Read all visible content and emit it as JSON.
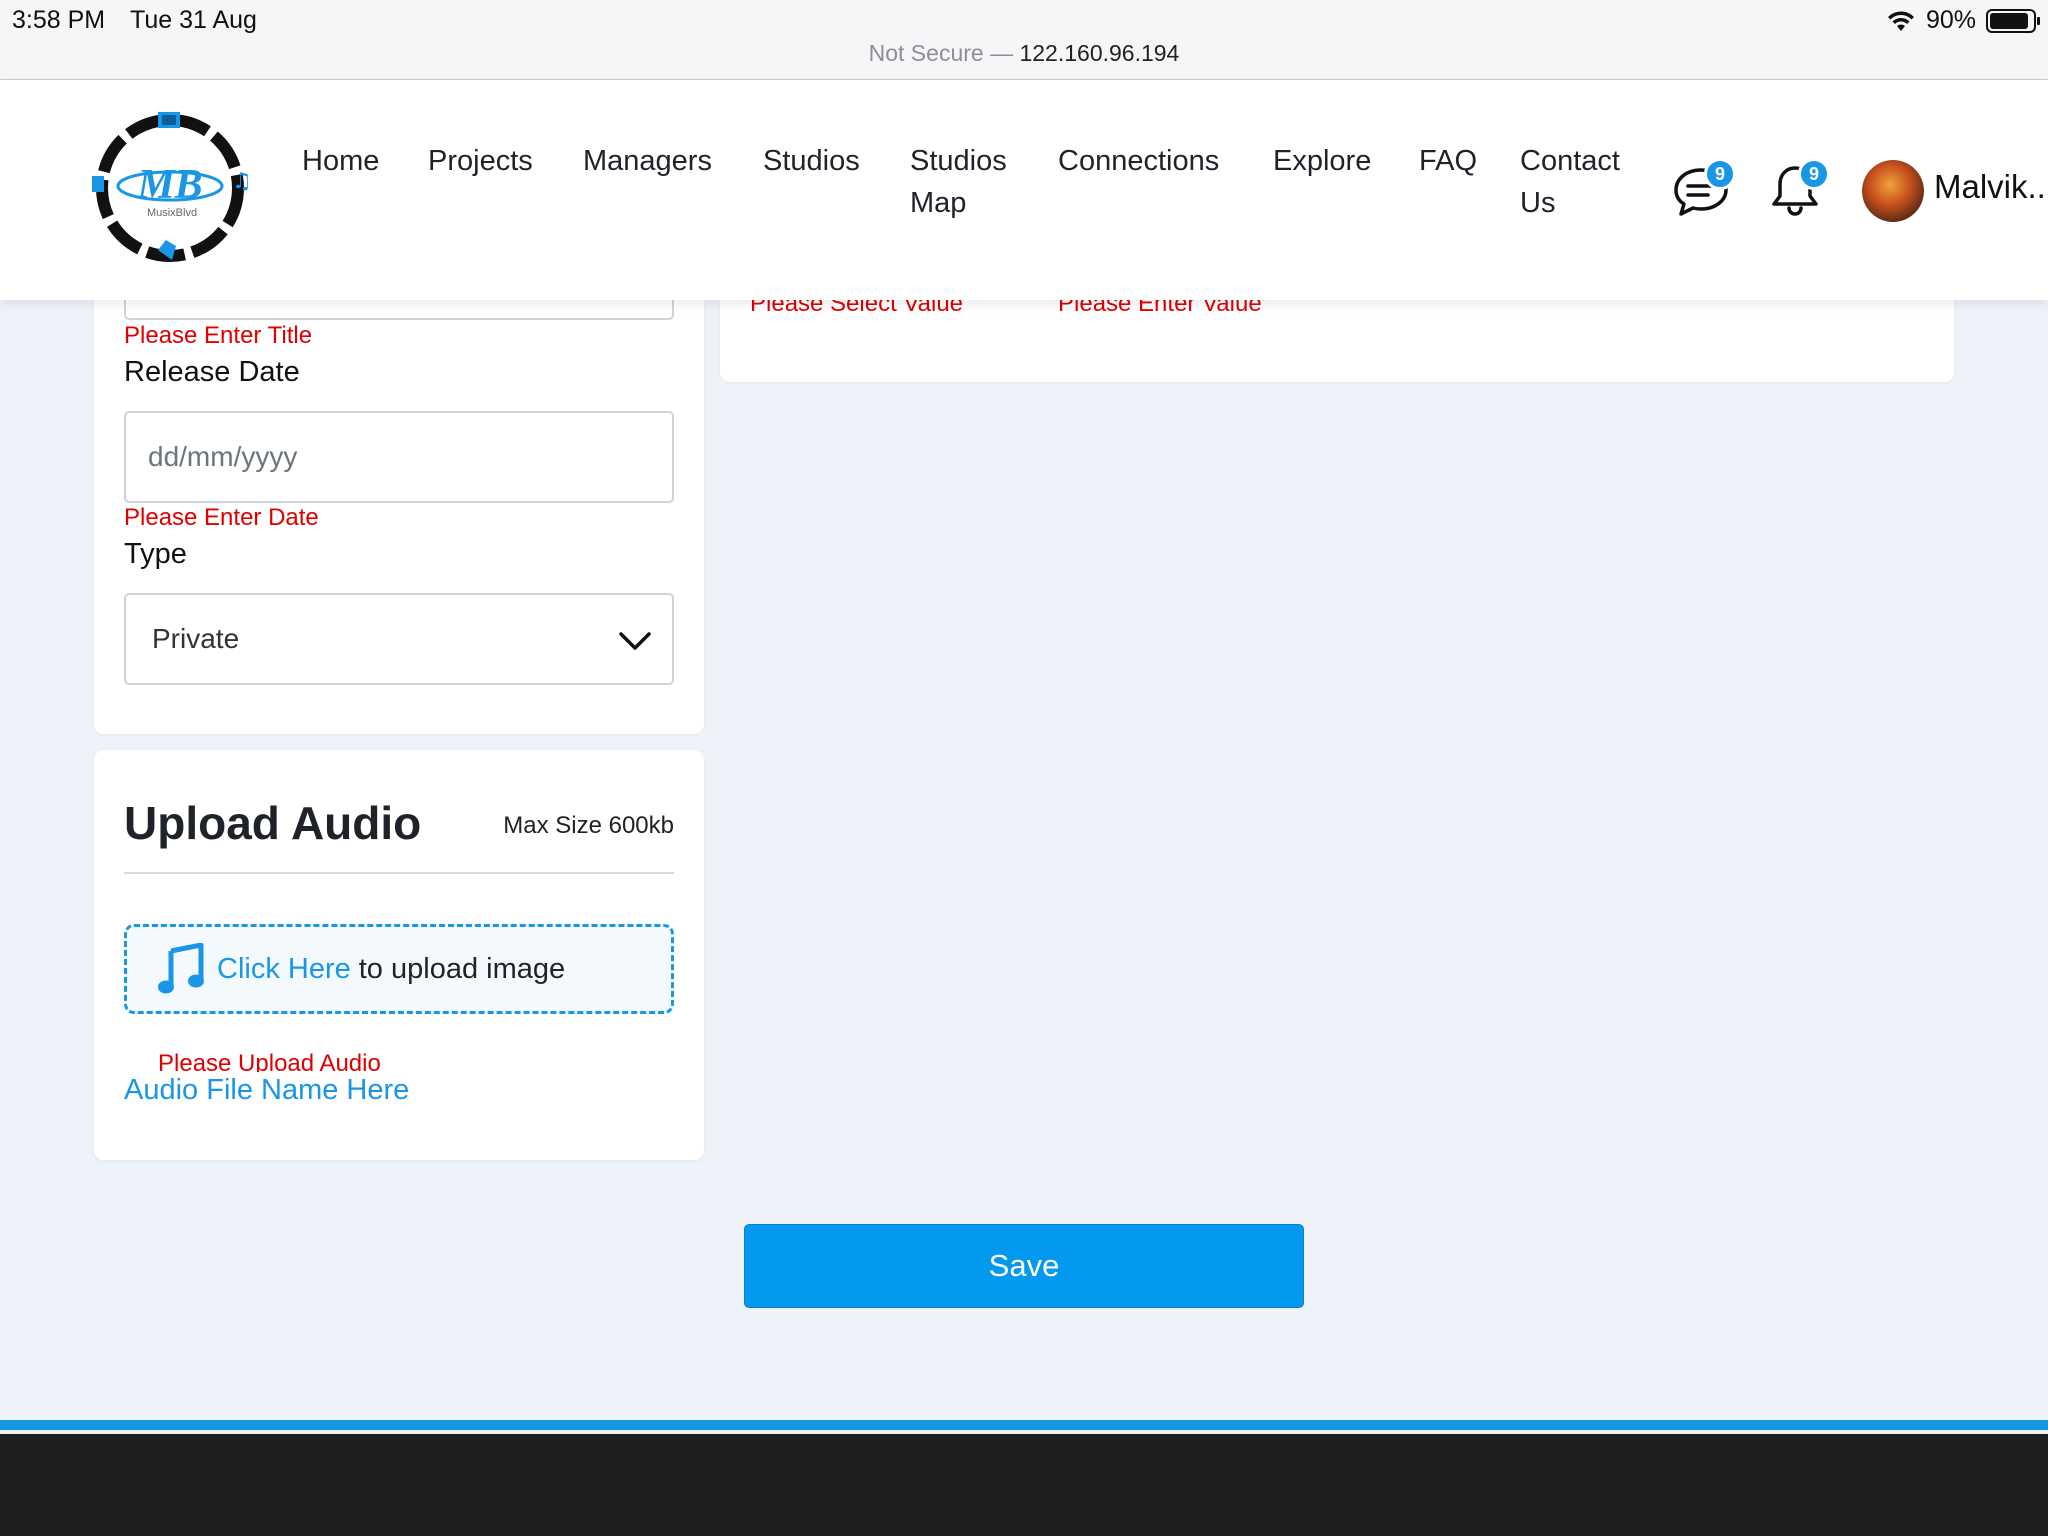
{
  "status_bar": {
    "time": "3:58 PM",
    "date": "Tue 31 Aug",
    "battery_percent": "90%",
    "battery_level": 0.9
  },
  "url_bar": {
    "prefix": "Not Secure —",
    "host": "122.160.96.194"
  },
  "nav": {
    "items": [
      {
        "label": "Home"
      },
      {
        "label": "Projects"
      },
      {
        "label": "Managers"
      },
      {
        "label": "Studios"
      },
      {
        "label_line1": "Studios",
        "label_line2": "Map"
      },
      {
        "label": "Connections"
      },
      {
        "label": "Explore"
      },
      {
        "label": "FAQ"
      },
      {
        "label_line1": "Contact",
        "label_line2": "Us"
      }
    ],
    "chat_badge": "9",
    "notification_badge": "9",
    "user_name": "Malvik..",
    "logo": {
      "text": "MB",
      "subtext": "MusixBlvd",
      "colors": {
        "ring": "#111111",
        "accent": "#1a96e6"
      }
    }
  },
  "form": {
    "title_error": "Please Enter Title",
    "release_date": {
      "label": "Release Date",
      "placeholder": "dd/mm/yyyy",
      "error": "Please Enter Date"
    },
    "type": {
      "label": "Type",
      "selected": "Private"
    },
    "right_errors": {
      "select": "Please Select Value",
      "enter": "Please Enter Value"
    }
  },
  "upload": {
    "title": "Upload Audio",
    "max_size": "Max Size 600kb",
    "click_here": "Click Here",
    "rest_text": "to upload image",
    "error": "Please Upload Audio",
    "file_name": "Audio File Name Here"
  },
  "save_label": "Save",
  "colors": {
    "accent": "#0399ee",
    "error": "#e00000",
    "page_bg": "#eef2f9",
    "footer": "#1e1f21"
  }
}
